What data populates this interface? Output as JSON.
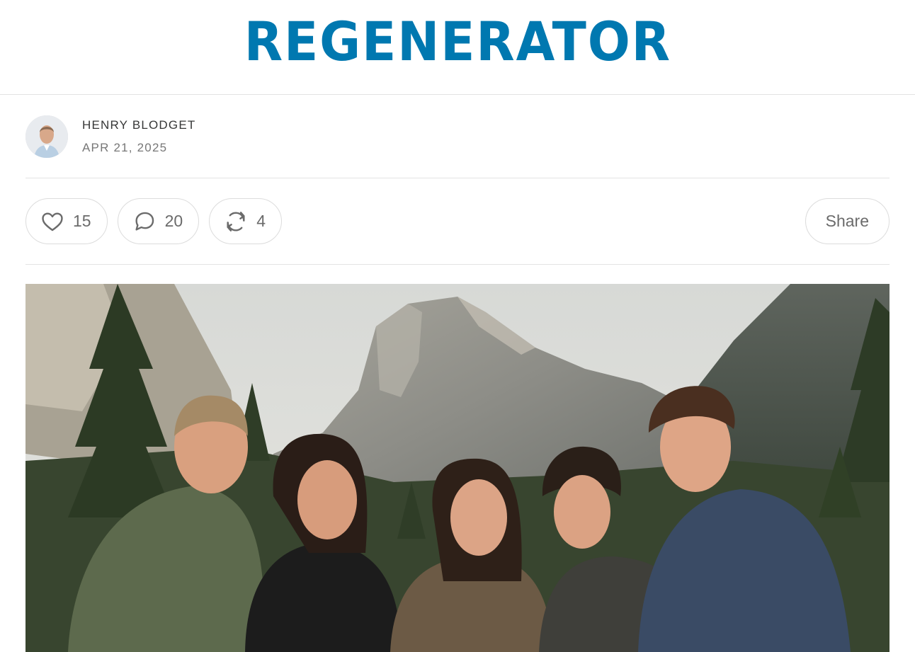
{
  "brand": {
    "logo_text": "REGENERATOR",
    "color": "#0078B0"
  },
  "post": {
    "author": "HENRY BLODGET",
    "date": "APR 21, 2025"
  },
  "actions": {
    "like": {
      "icon": "heart-icon",
      "count": "15"
    },
    "comment": {
      "icon": "comment-icon",
      "count": "20"
    },
    "restack": {
      "icon": "restack-icon",
      "count": "4"
    },
    "share_label": "Share"
  },
  "hero_image": {
    "subject": "family-photo-yosemite-half-dome"
  }
}
